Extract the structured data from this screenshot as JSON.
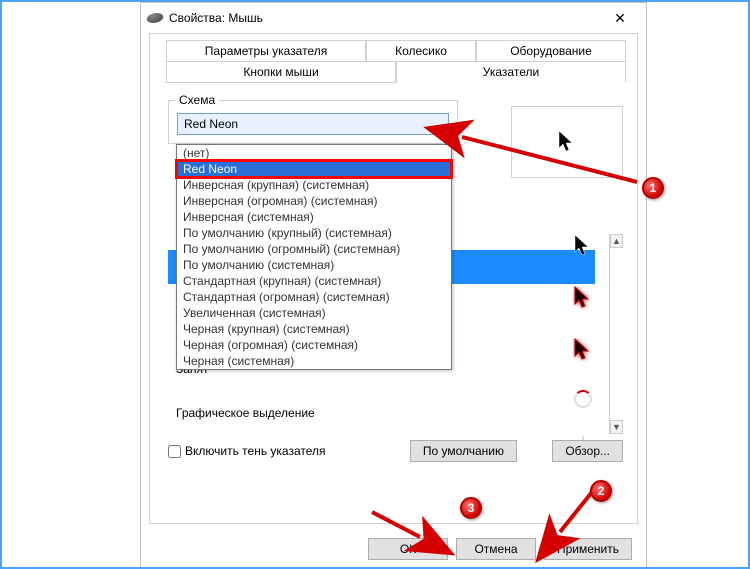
{
  "window": {
    "title": "Свойства: Мышь",
    "close_glyph": "✕"
  },
  "tabs": {
    "row1": [
      "Параметры указателя",
      "Колесико",
      "Оборудование"
    ],
    "row2": [
      "Кнопки мыши",
      "Указатели"
    ],
    "active": "Указатели"
  },
  "scheme": {
    "legend": "Схема",
    "selected": "Red Neon",
    "options": [
      "(нет)",
      "Red Neon",
      "Инверсная (крупная) (системная)",
      "Инверсная (огромная) (системная)",
      "Инверсная (системная)",
      "По умолчанию (крупный) (системная)",
      "По умолчанию (огромный) (системная)",
      "По умолчанию (системная)",
      "Стандартная (крупная) (системная)",
      "Стандартная (огромная) (системная)",
      "Увеличенная (системная)",
      "Черная (крупная) (системная)",
      "Черная (огромная) (системная)",
      "Черная (системная)"
    ]
  },
  "labels": {
    "busy": "Занят",
    "graphic_selection": "Графическое выделение",
    "shadow_checkbox": "Включить тень указателя"
  },
  "buttons": {
    "defaults": "По умолчанию",
    "browse": "Обзор...",
    "ok": "ОК",
    "cancel": "Отмена",
    "apply": "Применить"
  },
  "callouts": {
    "c1": "1",
    "c2": "2",
    "c3": "3"
  }
}
